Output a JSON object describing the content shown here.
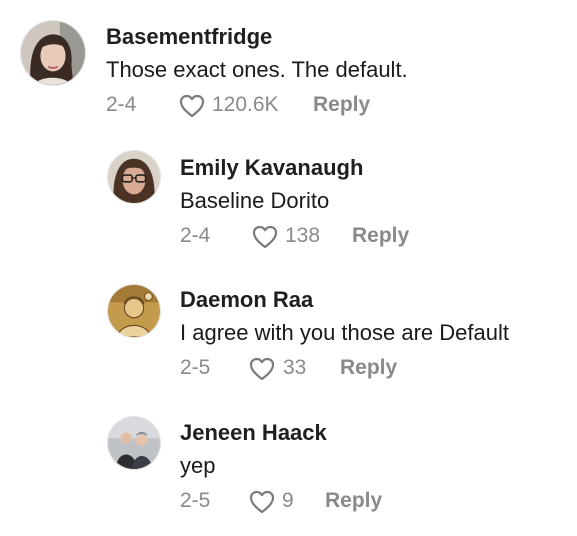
{
  "comments": [
    {
      "username": "Basementfridge",
      "text": "Those exact ones. The default.",
      "date": "2-4",
      "likes": "120.6K",
      "reply_label": "Reply",
      "avatar_icon": "profile-photo-woman"
    },
    {
      "username": "Emily Kavanaugh",
      "text": "Baseline Dorito",
      "date": "2-4",
      "likes": "138",
      "reply_label": "Reply",
      "avatar_icon": "profile-photo-woman-glasses"
    },
    {
      "username": "Daemon Raa",
      "text": "I agree with you those are Default",
      "date": "2-5",
      "likes": "33",
      "reply_label": "Reply",
      "avatar_icon": "profile-photo-illustration"
    },
    {
      "username": "Jeneen Haack",
      "text": "yep",
      "date": "2-5",
      "likes": "9",
      "reply_label": "Reply",
      "avatar_icon": "profile-photo-couple"
    }
  ],
  "colors": {
    "username": "#1f1f1f",
    "text": "#1a1a1a",
    "meta": "#8a8a8a",
    "background": "#ffffff"
  }
}
